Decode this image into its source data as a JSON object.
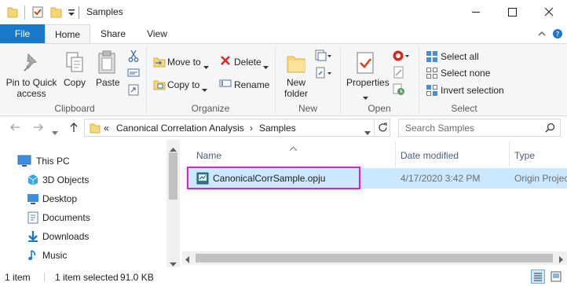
{
  "window": {
    "title": "Samples"
  },
  "tabs": {
    "file": "File",
    "home": "Home",
    "share": "Share",
    "view": "View"
  },
  "ribbon": {
    "clipboard": {
      "pin_line1": "Pin to Quick",
      "pin_line2": "access",
      "copy": "Copy",
      "paste": "Paste",
      "group": "Clipboard"
    },
    "organize": {
      "move_to": "Move to",
      "copy_to": "Copy to",
      "delete": "Delete",
      "rename": "Rename",
      "group": "Organize"
    },
    "new": {
      "folder_line1": "New",
      "folder_line2": "folder",
      "group": "New"
    },
    "open": {
      "properties": "Properties",
      "group": "Open"
    },
    "select": {
      "select_all": "Select all",
      "select_none": "Select none",
      "invert": "Invert selection",
      "group": "Select"
    }
  },
  "address": {
    "prefix": "«",
    "crumbs": [
      "Canonical Correlation Analysis",
      "Samples"
    ],
    "separator": "›",
    "search_placeholder": "Search Samples"
  },
  "nav_pane": {
    "items": [
      {
        "label": "This PC",
        "icon": "this-pc-icon"
      },
      {
        "label": "3D Objects",
        "icon": "3d-objects-icon"
      },
      {
        "label": "Desktop",
        "icon": "desktop-icon"
      },
      {
        "label": "Documents",
        "icon": "documents-icon"
      },
      {
        "label": "Downloads",
        "icon": "downloads-icon"
      },
      {
        "label": "Music",
        "icon": "music-icon"
      }
    ]
  },
  "file_list": {
    "columns": [
      "Name",
      "Date modified",
      "Type"
    ],
    "rows": [
      {
        "name": "CanonicalCorrSample.opju",
        "date": "4/17/2020 3:42 PM",
        "type": "Origin Project"
      }
    ]
  },
  "status": {
    "count": "1 item",
    "selected": "1 item selected",
    "size": "91.0 KB"
  },
  "colors": {
    "file_tab": "#1979ca",
    "selection": "#cce8ff",
    "highlight_box": "#e020c8",
    "column_header": "#4c607a"
  }
}
